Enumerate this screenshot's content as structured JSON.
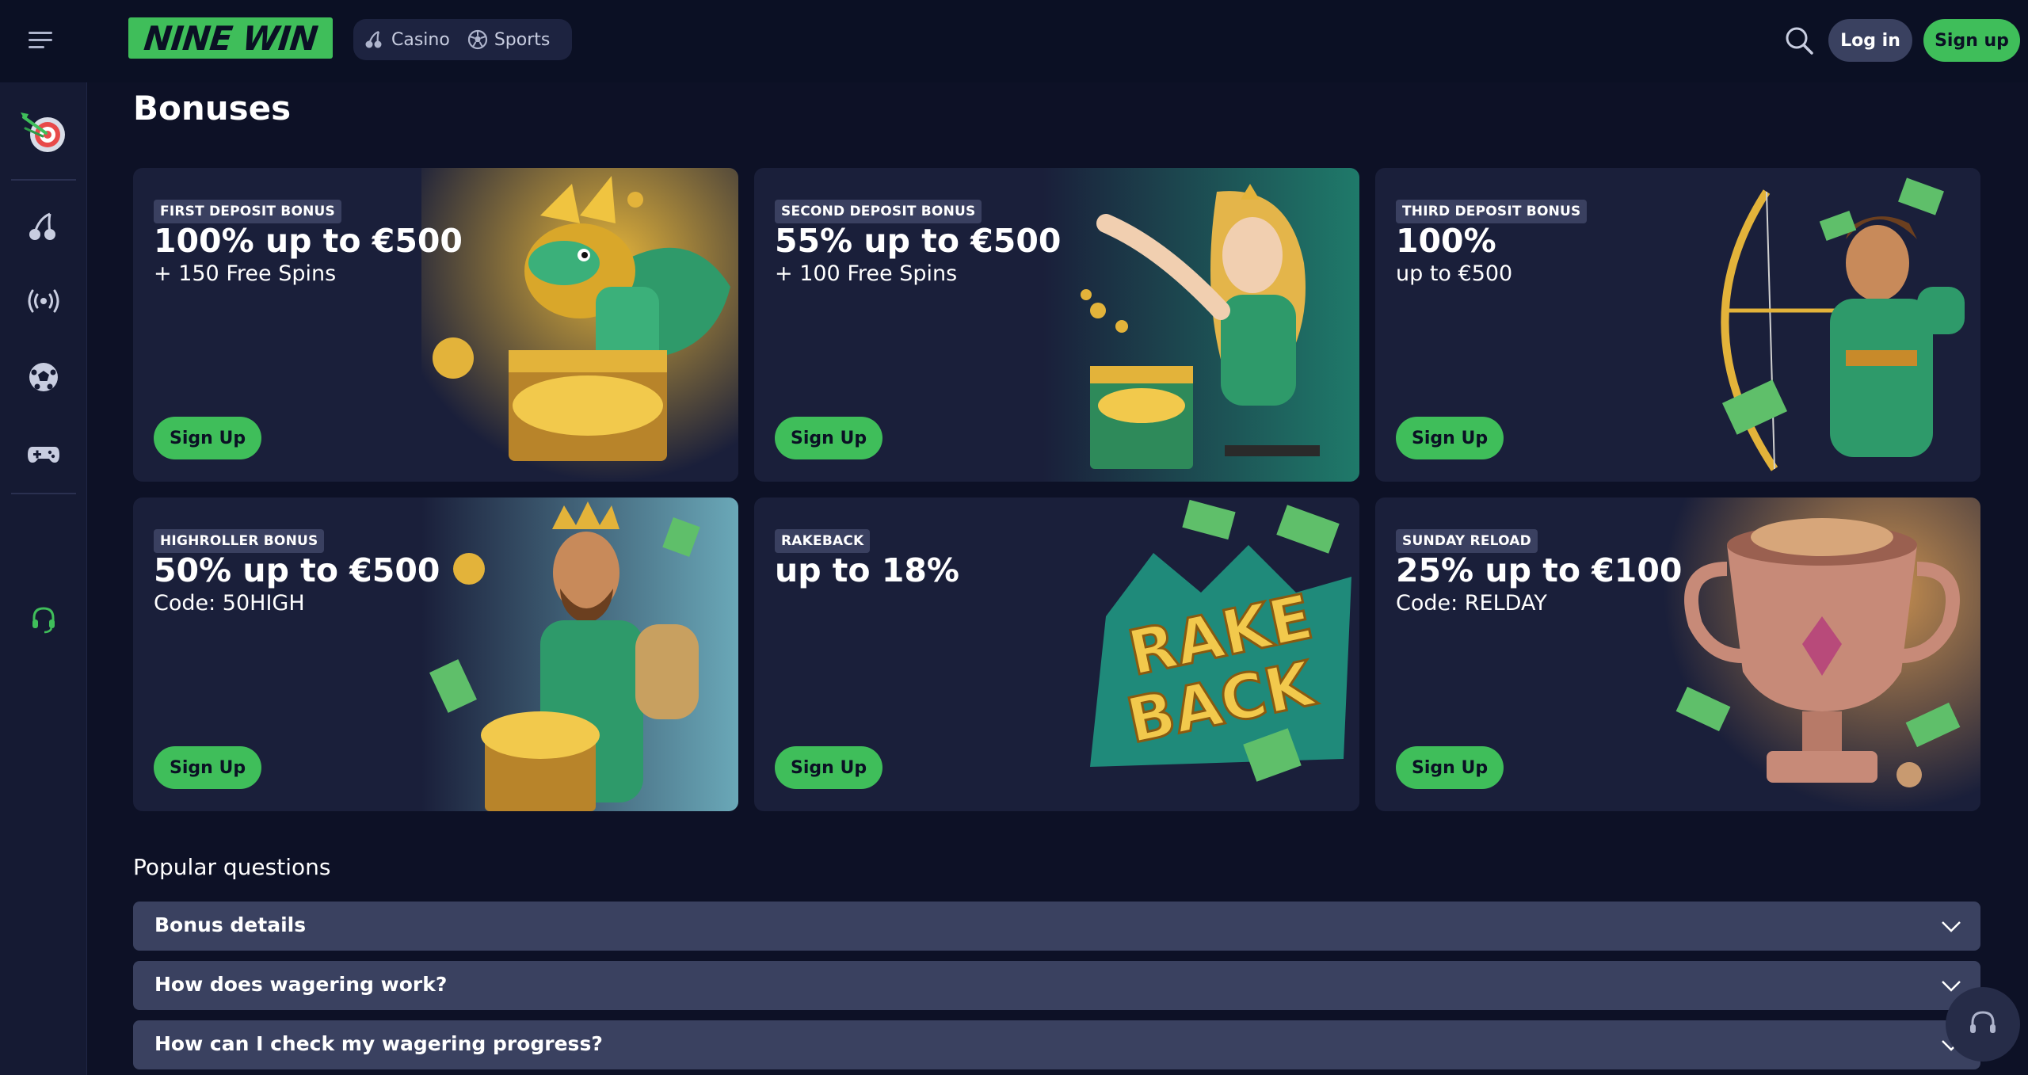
{
  "header": {
    "logo_text": "NINE WIN",
    "nav": [
      {
        "label": "Casino",
        "icon": "cherry-icon"
      },
      {
        "label": "Sports",
        "icon": "soccer-ball-icon"
      }
    ],
    "login_label": "Log in",
    "signup_label": "Sign up"
  },
  "sidebar": {
    "items": [
      {
        "icon": "dart-target-icon"
      },
      {
        "icon": "cherry-icon"
      },
      {
        "icon": "live-broadcast-icon"
      },
      {
        "icon": "soccer-ball-icon"
      },
      {
        "icon": "gamepad-icon"
      },
      {
        "icon": "headset-icon"
      }
    ]
  },
  "page": {
    "title": "Bonuses"
  },
  "bonuses": [
    {
      "badge": "FIRST DEPOSIT BONUS",
      "title": "100% up to €500",
      "subtitle": "+ 150 Free Spins",
      "button": "Sign Up",
      "art": "dragon-treasure-art"
    },
    {
      "badge": "SECOND DEPOSIT BONUS",
      "title": "55% up to €500",
      "subtitle": "+ 100 Free Spins",
      "button": "Sign Up",
      "art": "heroine-treasure-art"
    },
    {
      "badge": "THIRD DEPOSIT BONUS",
      "title": "100%",
      "subtitle": "up to €500",
      "button": "Sign Up",
      "art": "archer-art"
    },
    {
      "badge": "HIGHROLLER BONUS",
      "title": "50% up to €500",
      "subtitle": "Code: 50HIGH",
      "button": "Sign Up",
      "art": "king-treasure-art"
    },
    {
      "badge": "RAKEBACK",
      "title": "up to 18%",
      "subtitle": "",
      "button": "Sign Up",
      "art": "rakeback-art",
      "art_text": "RAKE BACK"
    },
    {
      "badge": "SUNDAY RELOAD",
      "title": "25% up to €100",
      "subtitle": "Code: RELDAY",
      "button": "Sign Up",
      "art": "trophy-art"
    }
  ],
  "faq": {
    "title": "Popular questions",
    "items": [
      {
        "question": "Bonus details"
      },
      {
        "question": "How does wagering work?"
      },
      {
        "question": "How can I check my wagering progress?"
      }
    ]
  },
  "colors": {
    "background": "#0d1126",
    "card": "#1a1f3a",
    "accent": "#3fbe5a",
    "faq_bg": "#3a4160"
  }
}
